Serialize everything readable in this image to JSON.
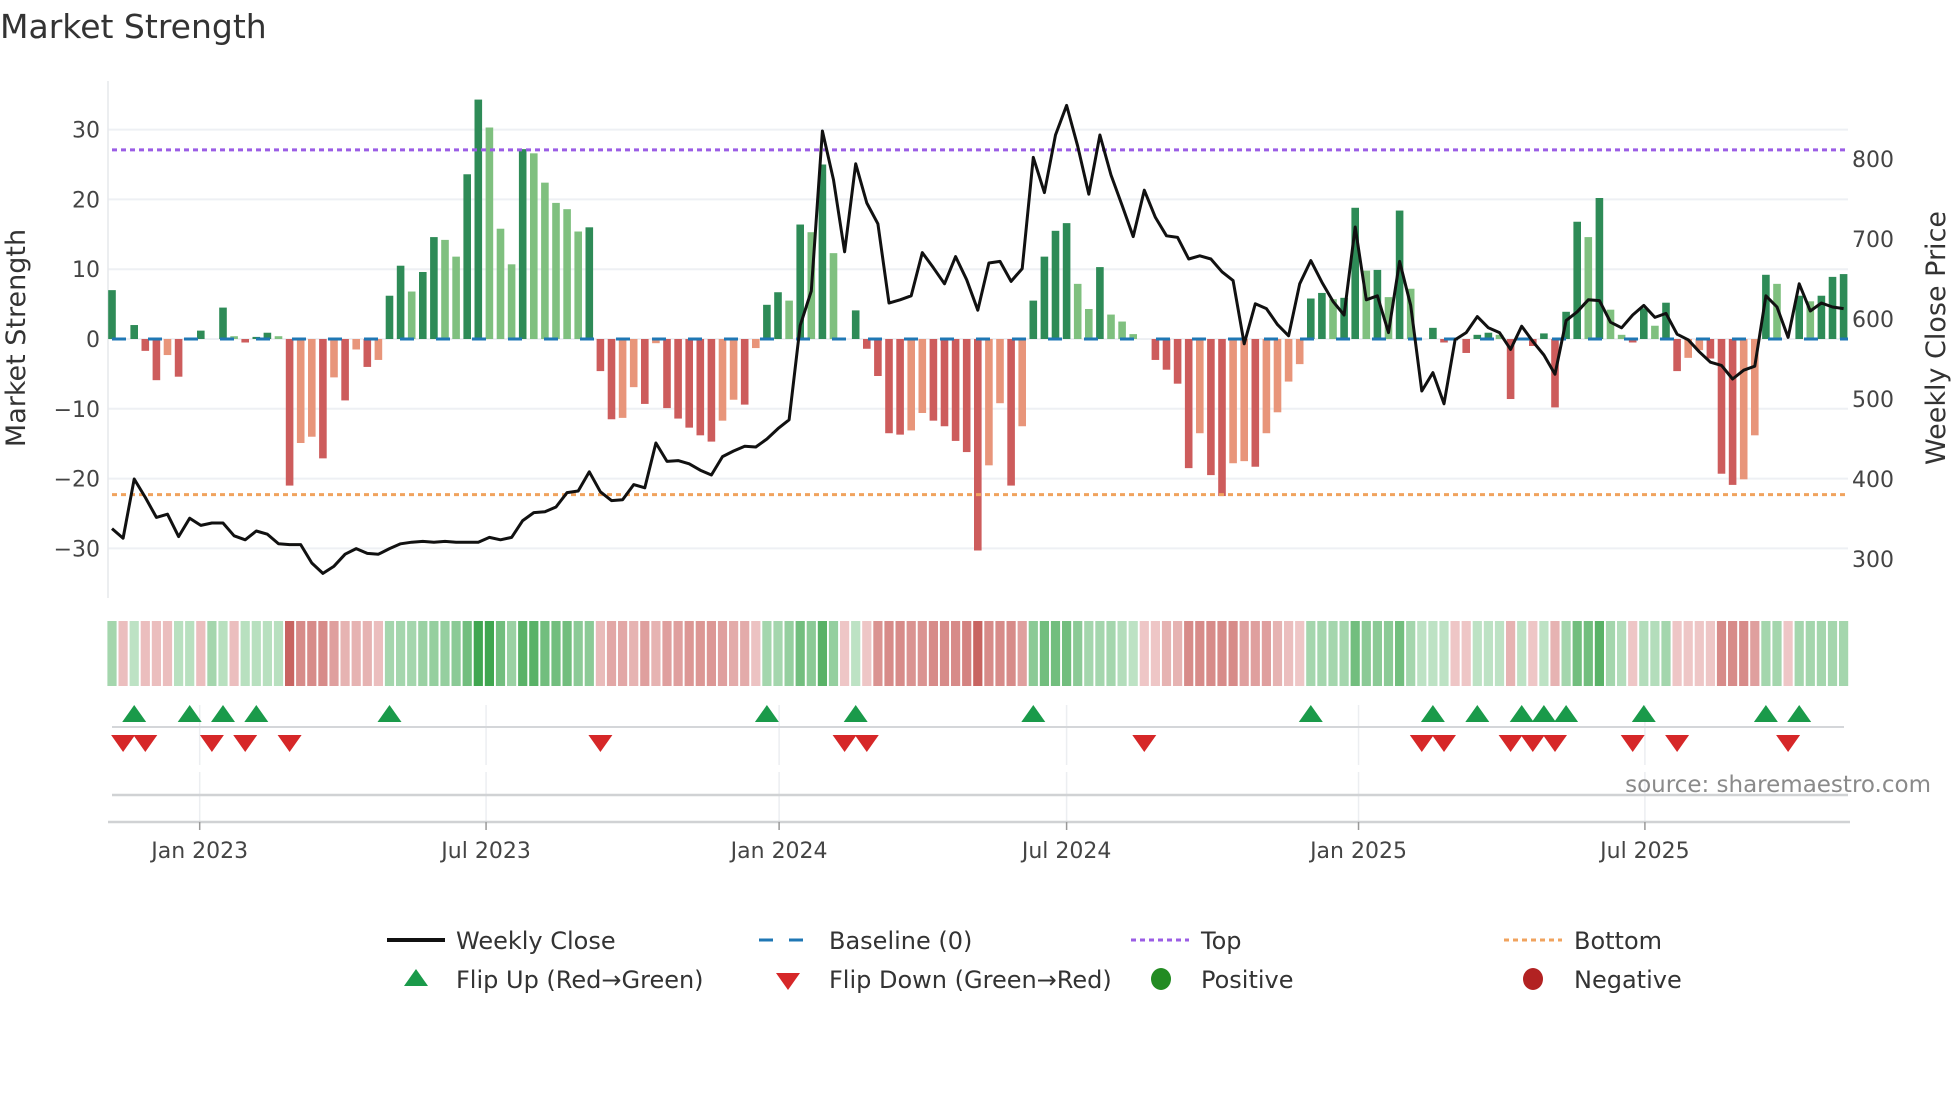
{
  "title": "Market Strength",
  "source": "source: sharemaestro.com",
  "colors": {
    "pos_dark": "#2e8b57",
    "pos_light": "#7fc07f",
    "neg_dark": "#cd5c5c",
    "neg_light": "#e8957a",
    "baseline": "#1f77b4",
    "top": "#9b5de5",
    "bottom": "#f0a35e",
    "line": "#111111",
    "flip_up": "#1a9a4a",
    "flip_down": "#d62728",
    "positive": "#228b22",
    "negative": "#b22222"
  },
  "chart_data": {
    "type": "bar",
    "title": "Market Strength",
    "ylabel": "Market Strength",
    "y2label": "Weekly Close Price",
    "ylim": [
      -38,
      38
    ],
    "y2lim": [
      245,
      920
    ],
    "yticks": [
      30,
      20,
      10,
      0,
      -10,
      -20,
      -30
    ],
    "y2ticks": [
      800,
      700,
      600,
      500,
      400,
      300
    ],
    "top_level": 27.1,
    "bottom_level": -22.3,
    "x_unit": "week index",
    "xticks": [
      {
        "label": "Jan 2023",
        "week": 7.9
      },
      {
        "label": "Jul 2023",
        "week": 33.7
      },
      {
        "label": "Jan 2024",
        "week": 60.1
      },
      {
        "label": "Jul 2024",
        "week": 86.0
      },
      {
        "label": "Jan 2025",
        "week": 112.3
      },
      {
        "label": "Jul 2025",
        "week": 138.1
      }
    ],
    "strength": [
      7,
      0,
      2,
      -1.7,
      -5.9,
      -2.3,
      -5.4,
      0,
      1.2,
      0,
      4.5,
      0.4,
      -0.5,
      0.3,
      0.9,
      0.4,
      -21,
      -14.9,
      -14,
      -17.1,
      -5.5,
      -8.8,
      -1.5,
      -4,
      -3,
      6.2,
      10.5,
      6.8,
      9.6,
      14.6,
      14.2,
      11.8,
      23.6,
      34.3,
      30.3,
      15.8,
      10.7,
      27.2,
      26.6,
      22.4,
      19.5,
      18.6,
      15.4,
      16,
      -4.6,
      -11.5,
      -11.3,
      -6.9,
      -9.3,
      -0.6,
      -9.9,
      -11.4,
      -12.7,
      -13.8,
      -14.7,
      -11.7,
      -8.7,
      -9.4,
      -1.3,
      4.9,
      6.7,
      5.5,
      16.4,
      15.3,
      25,
      12.3,
      0,
      4.1,
      -1.4,
      -5.3,
      -13.5,
      -13.7,
      -13.1,
      -10.6,
      -11.7,
      -12.5,
      -14.6,
      -16.2,
      -30.3,
      -18.1,
      -9.2,
      -21,
      -12.5,
      5.5,
      11.8,
      15.5,
      16.6,
      7.9,
      4.3,
      10.3,
      3.5,
      2.5,
      0.7,
      0,
      -3,
      -4.4,
      -6.4,
      -18.5,
      -13.5,
      -19.5,
      -22.5,
      -17.8,
      -17.5,
      -18.3,
      -13.5,
      -10.5,
      -6.1,
      -3.6,
      5.8,
      6.6,
      5.7,
      5.9,
      18.8,
      9.8,
      9.9,
      6,
      18.4,
      7.2,
      0,
      1.6,
      -0.5,
      0,
      -2,
      0.6,
      0.9,
      0.6,
      -8.6,
      0,
      -1,
      0.8,
      -9.8,
      3.9,
      16.8,
      14.6,
      20.2,
      4.2,
      0.6,
      -0.5,
      4.4,
      1.9,
      5.2,
      -4.6,
      -2.7,
      -1.6,
      -2.8,
      -19.3,
      -20.9,
      -20.1,
      -13.8,
      9.2,
      7.9,
      0,
      6.2,
      5.4,
      6.2,
      8.9,
      9.3
    ],
    "weekly_close": [
      338,
      326,
      400,
      377,
      352,
      356,
      328,
      351,
      342,
      345,
      345,
      329,
      324,
      335,
      331,
      319,
      318,
      318,
      295,
      282,
      291,
      306,
      313,
      307,
      306,
      313,
      319,
      321,
      322,
      321,
      322,
      321,
      321,
      321,
      327,
      324,
      327,
      348,
      358,
      359,
      365,
      383,
      385,
      409,
      384,
      373,
      374,
      393,
      389,
      445,
      422,
      423,
      419,
      411,
      405,
      428,
      435,
      441,
      440,
      450,
      463,
      474,
      592,
      635,
      835,
      774,
      684,
      794,
      745,
      719,
      620,
      624,
      629,
      683,
      664,
      644,
      678,
      649,
      611,
      670,
      672,
      647,
      663,
      802,
      758,
      830,
      867,
      816,
      756,
      830,
      780,
      742,
      703,
      761,
      727,
      704,
      702,
      675,
      679,
      675,
      659,
      648,
      569,
      619,
      613,
      593,
      579,
      644,
      673,
      646,
      622,
      605,
      715,
      624,
      629,
      583,
      672,
      617,
      510,
      533,
      494,
      574,
      583,
      603,
      589,
      583,
      562,
      591,
      572,
      555,
      531,
      598,
      609,
      624,
      623,
      596,
      589,
      605,
      617,
      602,
      607,
      581,
      574,
      559,
      546,
      542,
      525,
      536,
      541,
      629,
      615,
      577,
      644,
      610,
      620,
      615,
      613
    ],
    "heat": [
      1,
      -0.7,
      0.5,
      -0.7,
      -0.7,
      -0.7,
      0.6,
      0.6,
      -0.7,
      1,
      0.6,
      -0.7,
      0.6,
      0.6,
      0.6,
      0.6,
      -3,
      -2,
      -2,
      -2,
      -1.5,
      -1,
      -1,
      -1,
      -0.7,
      1,
      1,
      1,
      1.2,
      1.3,
      1.3,
      1.5,
      2,
      3,
      3,
      2,
      1.2,
      2.5,
      2.5,
      2,
      2,
      2,
      1.5,
      1.5,
      -0.8,
      -1.3,
      -1.3,
      -1,
      -1.5,
      -1,
      -1.5,
      -1.5,
      -1.7,
      -1.7,
      -1.7,
      -1.5,
      -1.2,
      -1.2,
      -0.6,
      1,
      1,
      1.3,
      2,
      1.5,
      2.5,
      1.3,
      -0.5,
      0.5,
      -0.5,
      -1.8,
      -2,
      -2,
      -1.8,
      -1.8,
      -2,
      -2,
      -2,
      -2.2,
      -3,
      -2,
      -2,
      -2,
      -1.5,
      1.5,
      2,
      2,
      2,
      1.5,
      1,
      1,
      1,
      0.7,
      0.5,
      -0.5,
      -0.5,
      -1,
      -1,
      -2,
      -2,
      -2,
      -2,
      -2,
      -1.5,
      -1.5,
      -1.5,
      -1,
      -0.7,
      -0.5,
      1,
      1,
      1,
      1,
      2,
      1.5,
      1.5,
      1.5,
      2,
      1,
      0.5,
      0.5,
      0.5,
      -0.5,
      -0.5,
      0.5,
      0.5,
      0.5,
      -1,
      0.5,
      -0.5,
      0.5,
      -1,
      1,
      2,
      2,
      2.5,
      1,
      0.7,
      -0.5,
      0.7,
      0.7,
      1,
      -0.5,
      -0.5,
      -0.5,
      -0.5,
      -2,
      -2,
      -2,
      -1.5,
      1,
      1,
      -0.5,
      1,
      1,
      1,
      1,
      1
    ],
    "flip_up": [
      2,
      7,
      10,
      13,
      25,
      59,
      67,
      83,
      108,
      119,
      123,
      127,
      129,
      131,
      138,
      149,
      152
    ],
    "flip_down": [
      1,
      3,
      9,
      12,
      16,
      44,
      66,
      68,
      93,
      118,
      120,
      126,
      128,
      130,
      137,
      141,
      151
    ]
  },
  "legend": {
    "weekly_close": "Weekly Close",
    "baseline": "Baseline (0)",
    "top": "Top",
    "bottom": "Bottom",
    "flip_up": "Flip Up (Red→Green)",
    "flip_down": "Flip Down (Green→Red)",
    "positive": "Positive",
    "negative": "Negative"
  }
}
